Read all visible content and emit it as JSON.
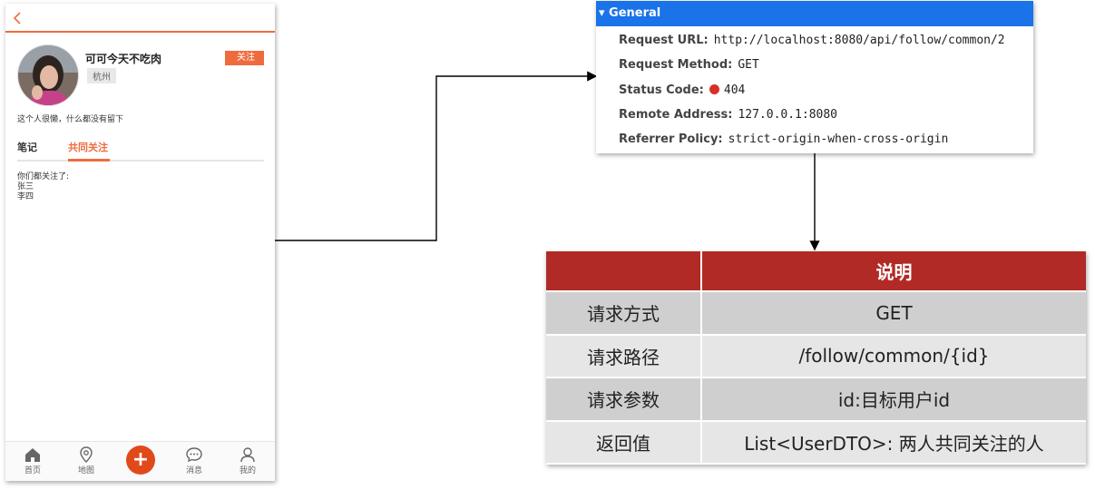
{
  "phone": {
    "nickname": "可可今天不吃肉",
    "city": "杭州",
    "follow_button": "关注",
    "intro": "这个人很懒，什么都没有留下",
    "tabs": [
      "笔记",
      "共同关注"
    ],
    "common_follows_title": "你们都关注了:",
    "common_follows": [
      "张三",
      "李四"
    ],
    "nav": [
      "首页",
      "地图",
      "消息",
      "我的"
    ],
    "plus": "+"
  },
  "general": {
    "header": "▾ General",
    "rows": [
      {
        "key": "Request URL:",
        "value": "http://localhost:8080/api/follow/common/2"
      },
      {
        "key": "Request Method:",
        "value": "GET"
      },
      {
        "key": "Status Code:",
        "value": "404"
      },
      {
        "key": "Remote Address:",
        "value": "127.0.0.1:8080"
      },
      {
        "key": "Referrer Policy:",
        "value": "strict-origin-when-cross-origin"
      }
    ],
    "status_color": "#d93025"
  },
  "table": {
    "header": [
      "",
      "说明"
    ],
    "rows": [
      [
        "请求方式",
        "GET"
      ],
      [
        "请求路径",
        "/follow/common/{id}"
      ],
      [
        "请求参数",
        "id:目标用户id"
      ],
      [
        "返回值",
        "List<UserDTO>: 两人共同关注的人"
      ]
    ]
  },
  "colors": {
    "accent": "#ef6b3e",
    "header_red": "#b22a26",
    "devtools_blue": "#1a73e8"
  }
}
